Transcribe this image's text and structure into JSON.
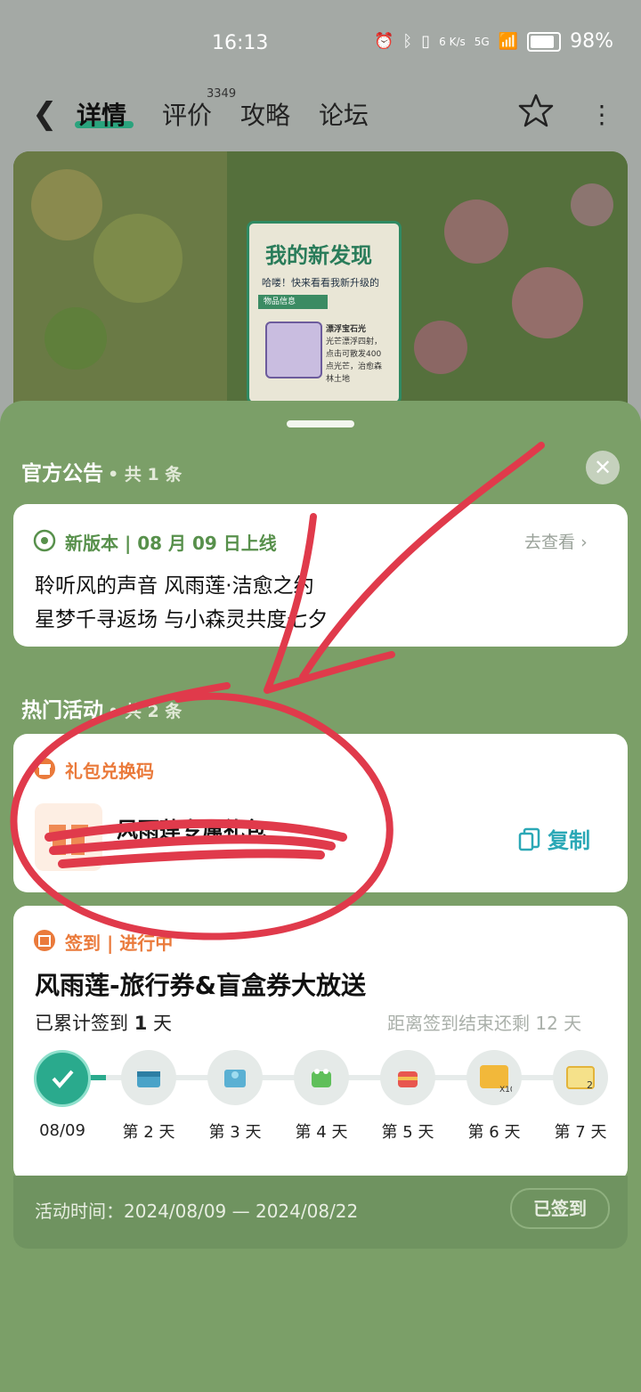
{
  "status_bar": {
    "time": "16:13",
    "net_speed": "6 K/s",
    "signal": "5G",
    "battery": "98%"
  },
  "nav": {
    "tabs": [
      {
        "label": "详情"
      },
      {
        "label": "评价"
      },
      {
        "label": "攻略"
      },
      {
        "label": "论坛"
      }
    ],
    "review_count": "3349"
  },
  "banner": {
    "note_title": "我的新发现",
    "note_subtitle": "哈喽！快来看看我新升级的",
    "note_tag": "物品信息",
    "item_name": "漂浮宝石光",
    "item_desc": "光芒漂浮四射，点击可散发400点光芒，治愈森林土地"
  },
  "announcement": {
    "title": "官方公告",
    "count": "• 共 1 条",
    "label": "新版本 | 08 月 09 日上线",
    "link": "去查看",
    "line1": "聆听风的声音 风雨莲·洁愈之约",
    "line2": "星梦千寻返场 与小森灵共度七夕"
  },
  "activities": {
    "title": "热门活动",
    "count": "• 共 2 条",
    "gift": {
      "label": "礼包兑换码",
      "name": "风雨莲专属礼包",
      "copy": "复制"
    },
    "checkin": {
      "tag": "签到 | 进行中",
      "title": "风雨莲-旅行券&盲盒券大放送",
      "accumulated_prefix": "已累计签到 ",
      "accumulated_days": "1",
      "accumulated_suffix": " 天",
      "remaining": "距离签到结束还剩 12 天",
      "days": [
        {
          "label": "08/09",
          "done": true
        },
        {
          "label": "第 2 天",
          "done": false
        },
        {
          "label": "第 3 天",
          "done": false
        },
        {
          "label": "第 4 天",
          "done": false
        },
        {
          "label": "第 5 天",
          "done": false
        },
        {
          "label": "第 6 天",
          "done": false
        },
        {
          "label": "第 7 天",
          "done": false
        }
      ],
      "activity_time": "活动时间：2024/08/09 — 2024/08/22",
      "signed": "已签到"
    }
  },
  "colors": {
    "accent": "#2aa37d",
    "sheet_bg": "#7b9f68",
    "orange": "#ea7a3b",
    "teal": "#2ba8b6",
    "scribble": "#e03a4b"
  }
}
